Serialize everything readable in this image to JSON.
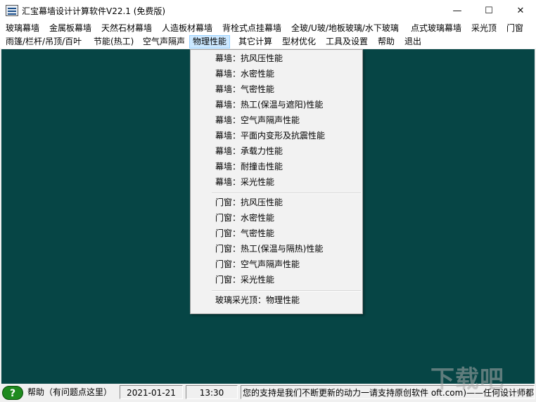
{
  "window": {
    "title": "汇宝幕墙设计计算软件V22.1  (免费版)",
    "minimize_glyph": "—",
    "maximize_glyph": "☐",
    "close_glyph": "✕"
  },
  "menubar": {
    "row1": [
      "玻璃幕墙",
      "金属板幕墙",
      "天然石材幕墙",
      "人造板材幕墙",
      "背栓式点挂幕墙",
      "全玻/U玻/地板玻璃/水下玻璃",
      "点式玻璃幕墙",
      "采光顶",
      "门窗"
    ],
    "row2": [
      "雨篷/栏杆/吊顶/百叶",
      "节能(热工)",
      "空气声隔声",
      "物理性能",
      "其它计算",
      "型材优化",
      "工具及设置",
      "帮助",
      "退出"
    ],
    "active": "物理性能"
  },
  "dropdown": {
    "group1": [
      "幕墙：抗风压性能",
      "幕墙：水密性能",
      "幕墙：气密性能",
      "幕墙：热工(保温与遮阳)性能",
      "幕墙：空气声隔声性能",
      "幕墙：平面内变形及抗震性能",
      "幕墙：承载力性能",
      "幕墙：耐撞击性能",
      "幕墙：采光性能"
    ],
    "group2": [
      "门窗：抗风压性能",
      "门窗：水密性能",
      "门窗：气密性能",
      "门窗：热工(保温与隔热)性能",
      "门窗：空气声隔声性能",
      "门窗：采光性能"
    ],
    "group3": [
      "玻璃采光顶：物理性能"
    ]
  },
  "statusbar": {
    "help_glyph": "?",
    "help_text": "帮助（有问题点这里）",
    "date": "2021-01-21",
    "time": "13:30",
    "message": "您的支持是我们不断更新的动力一请支持原创软件  oft.com)——任何设计师都"
  },
  "watermark": "下载吧",
  "colors": {
    "client_bg": "#064545",
    "menu_highlight": "#cce8ff",
    "help_icon": "#1f8a1f"
  }
}
